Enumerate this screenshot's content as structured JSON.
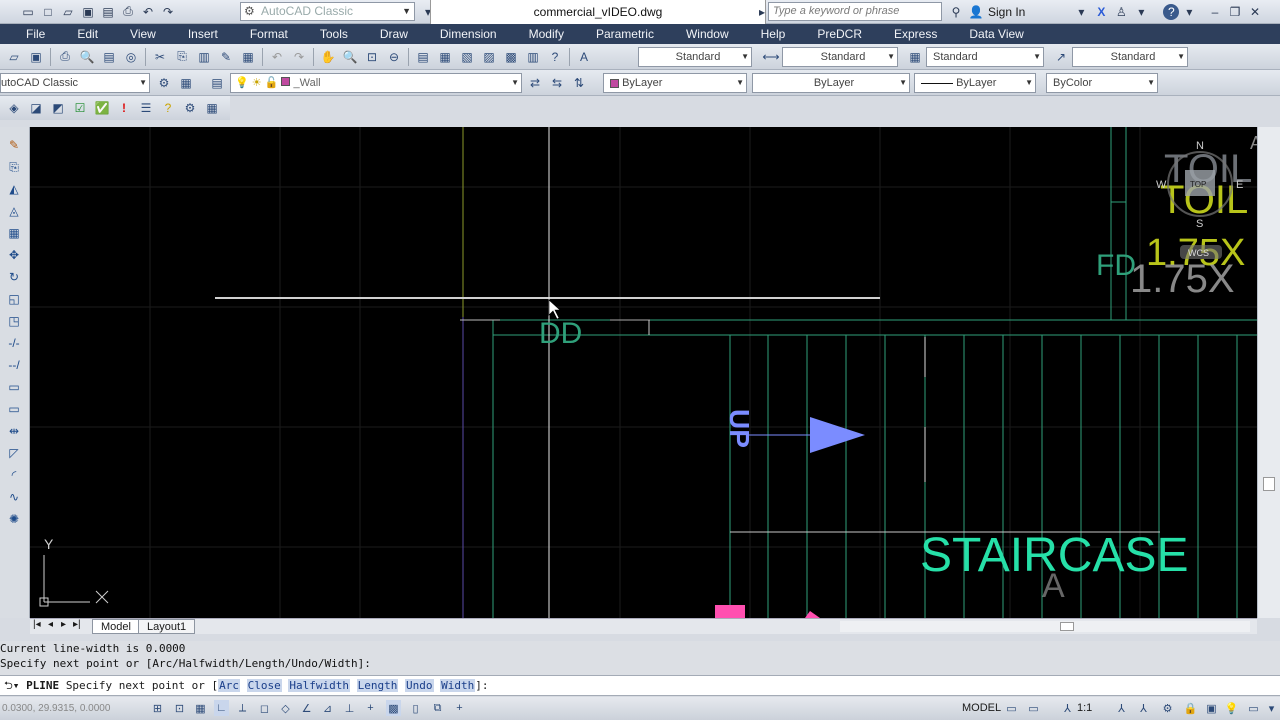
{
  "titlebar": {
    "workspace": "AutoCAD Classic",
    "document_title": "commercial_vIDEO.dwg",
    "search_placeholder": "Type a keyword or phrase",
    "signin": "Sign In"
  },
  "menubar": {
    "items": [
      "File",
      "Edit",
      "View",
      "Insert",
      "Format",
      "Tools",
      "Draw",
      "Dimension",
      "Modify",
      "Parametric",
      "Window",
      "Help",
      "PreDCR",
      "Express",
      "Data View"
    ]
  },
  "styles_toolbar": {
    "text_style": "Standard",
    "dim_style": "Standard",
    "table_style": "Standard",
    "mleader_style": "Standard"
  },
  "layers_toolbar": {
    "workspace": "utoCAD Classic",
    "layer": "_Wall",
    "color": "ByLayer",
    "linetype": "ByLayer",
    "lineweight": "ByLayer",
    "plotstyle": "ByColor"
  },
  "viewcube": {
    "north": "N",
    "south": "S",
    "west": "W",
    "east": "E",
    "face": "TOP",
    "wcs": "WCS"
  },
  "drawing": {
    "label_dd": "DD",
    "label_up": "UP",
    "label_staircase": "STAIRCASE",
    "label_toil": "TOIL",
    "label_toil_bg": "TOIL",
    "label_size": "1.75X",
    "label_size_bg": "1.75X",
    "label_fd": "FD",
    "label_a": "A",
    "ucs_y": "Y",
    "ucs_x": "X"
  },
  "tabs": {
    "model": "Model",
    "layout1": "Layout1"
  },
  "command": {
    "history_1": "Current line-width is 0.0000",
    "history_2": "Specify next point or [Arc/Halfwidth/Length/Undo/Width]:",
    "prompt_cmd": "PLINE",
    "prompt_text": "Specify next point or [",
    "options": [
      "Arc",
      "Close",
      "Halfwidth",
      "Length",
      "Undo",
      "Width"
    ],
    "prompt_end": "]:"
  },
  "status": {
    "coords": "0.0300, 29.9315, 0.0000",
    "model": "MODEL",
    "scale": "1:1"
  },
  "colors": {
    "canvas_bg": "#000000",
    "menubar_bg": "#2e3f5c",
    "wall_green": "#2fa07a",
    "staircase_text": "#26e0a8",
    "up_text": "#7b8cff",
    "toil_yellow": "#b8c41a"
  }
}
